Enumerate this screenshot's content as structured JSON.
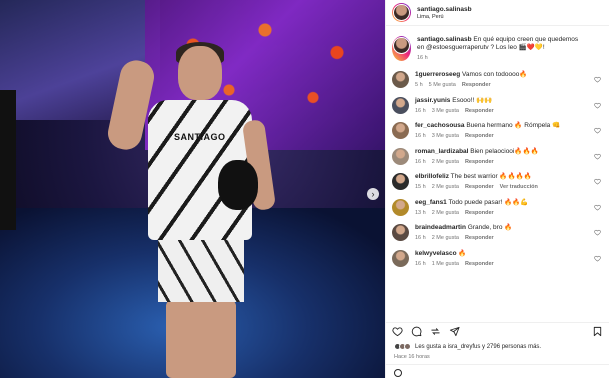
{
  "post": {
    "username": "santiago.salinasb",
    "location": "Lima, Perú",
    "caption": {
      "username": "santiago.salinasb",
      "text": "En qué equipo creen que quedemos en @estoesguerraperutv ? Los leo 🎬❤️💛!",
      "time": "16 h"
    }
  },
  "photo": {
    "shirt_text": "SANTIAGO",
    "next_icon": "chevron-right-icon"
  },
  "comments": [
    {
      "username": "1guerreroseeg",
      "text": "Vamos con todoooo🔥",
      "time": "5 h",
      "likes": "5 Me gusta",
      "reply": "Responder"
    },
    {
      "username": "jassir.yunis",
      "text": "Esooo!! 🙌🙌",
      "time": "16 h",
      "likes": "3 Me gusta",
      "reply": "Responder"
    },
    {
      "username": "fer_cachosousa",
      "text": "Buena hermano 🔥 Rómpela 👊",
      "time": "16 h",
      "likes": "3 Me gusta",
      "reply": "Responder"
    },
    {
      "username": "roman_lardizabal",
      "text": "Bien pelaociooi🔥🔥🔥",
      "time": "16 h",
      "likes": "2 Me gusta",
      "reply": "Responder"
    },
    {
      "username": "elbrillofeliz",
      "text": "The best warrior 🔥🔥🔥🔥",
      "time": "15 h",
      "likes": "2 Me gusta",
      "reply": "Responder",
      "extra": "Ver traducción"
    },
    {
      "username": "eeg_fans1",
      "text": "Todo puede pasar! 🔥🔥💪",
      "time": "13 h",
      "likes": "2 Me gusta",
      "reply": "Responder"
    },
    {
      "username": "braindeadmartin",
      "text": "Grande, bro 🔥",
      "time": "16 h",
      "likes": "2 Me gusta",
      "reply": "Responder"
    },
    {
      "username": "kelwyvelasco",
      "text": "🔥",
      "time": "16 h",
      "likes": "1 Me gusta",
      "reply": "Responder"
    }
  ],
  "likes_text": "Les gusta a isra_dreyfus y 2796 personas más.",
  "timestamp": "Hace 16 horas",
  "icons": [
    "heart-icon",
    "comment-icon",
    "share-icon",
    "send-icon",
    "bookmark-icon"
  ]
}
